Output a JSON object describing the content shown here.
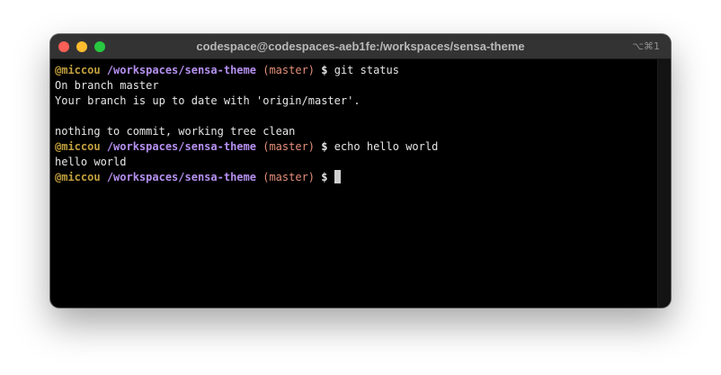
{
  "window": {
    "title": "codespace@codespaces-aeb1fe:/workspaces/sensa-theme",
    "shortcut": "⌥⌘1"
  },
  "prompt": {
    "user": "@miccou",
    "path": "/workspaces/sensa-theme",
    "branch": "(master)",
    "symbol": "$"
  },
  "terminal": {
    "commands": [
      "git status",
      "echo hello world"
    ],
    "output_git_status": [
      "On branch master",
      "Your branch is up to date with 'origin/master'.",
      "",
      "nothing to commit, working tree clean"
    ],
    "output_echo": [
      "hello world"
    ]
  },
  "colors": {
    "user": "#c2a03e",
    "path": "#b590f0",
    "branch": "#e58f7a",
    "close": "#ff5f57",
    "minimize": "#febc2e",
    "zoom": "#28c840"
  }
}
